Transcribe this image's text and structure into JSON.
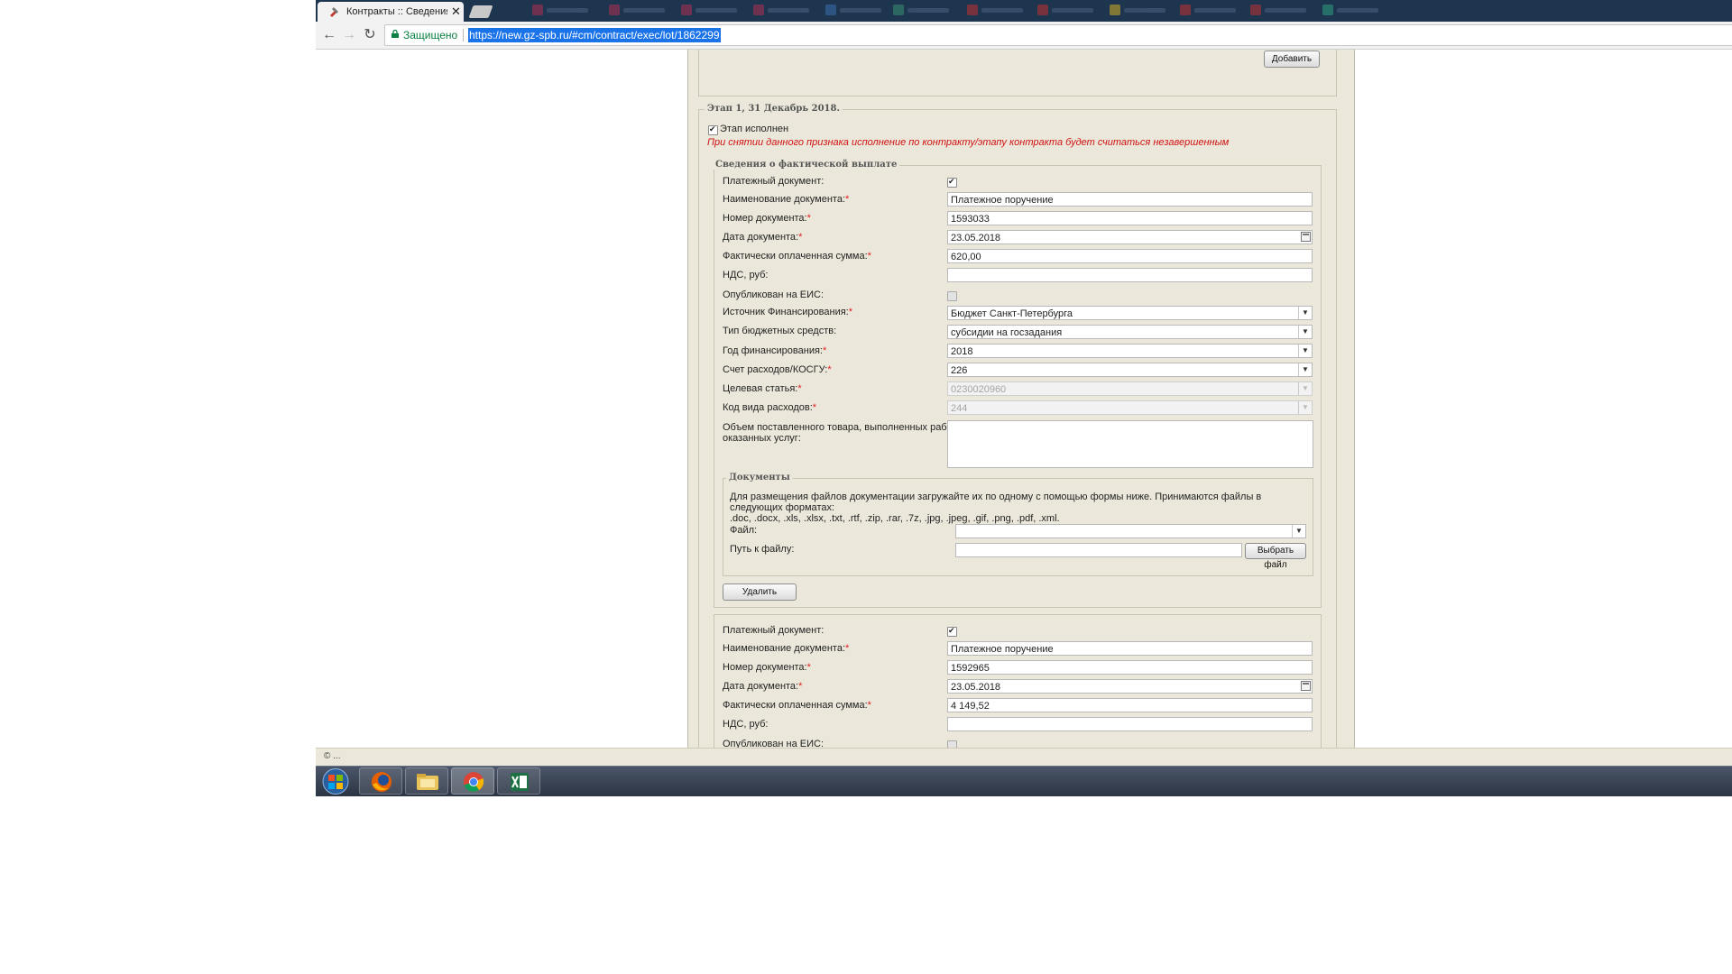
{
  "browser": {
    "active_tab_title": "Контракты :: Сведения о",
    "security_label": "Защищено",
    "url": "https://new.gz-spb.ru/#cm/contract/exec/lot/1862299"
  },
  "top_section": {
    "add_button": "Добавить"
  },
  "stage": {
    "legend": "Этап 1, 31 Декабрь 2018.",
    "executed_label": "Этап исполнен",
    "executed_checked": true,
    "warning": "При снятии данного признака исполнение по контракту/этапу контракта будет считаться незавершенным"
  },
  "payment_section_legend": "Сведения о фактической выплате",
  "required_marker": "*",
  "labels": {
    "payment_doc": "Платежный документ:",
    "doc_name": "Наименование документа:",
    "doc_number": "Номер документа:",
    "doc_date": "Дата документа:",
    "paid_sum": "Фактически оплаченная сумма:",
    "vat": "НДС, руб:",
    "published": "Опубликован на ЕИС:",
    "funding_source": "Источник Финансирования:",
    "budget_type": "Тип бюджетных средств:",
    "funding_year": "Год финансирования:",
    "expense_account": "Счет расходов/КОСГУ:",
    "target_article": "Целевая статья:",
    "expense_code": "Код вида расходов:",
    "volume_line1": "Объем поставленного товара, выполненных работ,",
    "volume_line2": "оказанных услуг:"
  },
  "payment1": {
    "payment_doc_checked": true,
    "doc_name": "Платежное поручение",
    "doc_number": "1593033",
    "doc_date": "23.05.2018",
    "paid_sum": "620,00",
    "vat": "",
    "published_checked": false,
    "funding_source": "Бюджет Санкт-Петербурга",
    "budget_type": "субсидии на госзадания",
    "funding_year": "2018",
    "expense_account": "226",
    "target_article": "0230020960",
    "expense_code": "244",
    "volume": ""
  },
  "documents": {
    "legend": "Документы",
    "info_line1": "Для размещения файлов документации загружайте их по одному с помощью формы ниже. Принимаются файлы в следующих форматах:",
    "info_line2": ".doc, .docx, .xls, .xlsx, .txt, .rtf, .zip, .rar, .7z, .jpg, .jpeg, .gif, .png, .pdf, .xml.",
    "file_label": "Файл:",
    "path_label": "Путь к файлу:",
    "choose_button": "Выбрать файл"
  },
  "delete_button": "Удалить",
  "payment2": {
    "payment_doc_checked": true,
    "doc_name": "Платежное поручение",
    "doc_number": "1592965",
    "doc_date": "23.05.2018",
    "paid_sum": "4 149,52",
    "vat": "",
    "published_checked": false
  },
  "status_bar": "© ...",
  "colors": {
    "panel_bg": "#ebe8db",
    "required": "#e02020",
    "warning": "#d01010",
    "url_highlight": "#1a73e8"
  },
  "icons": [
    "back-arrow-icon",
    "forward-arrow-icon",
    "reload-icon",
    "lock-icon",
    "calendar-icon",
    "chevron-down-icon",
    "windows-start-icon",
    "firefox-icon",
    "file-explorer-icon",
    "chrome-icon",
    "excel-icon"
  ]
}
